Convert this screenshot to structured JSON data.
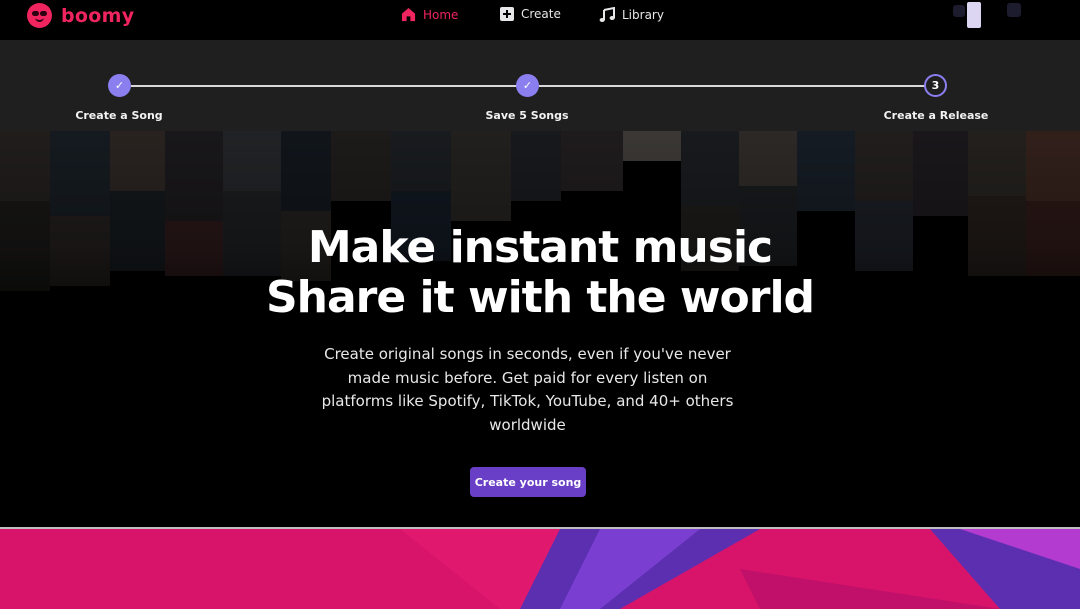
{
  "brand": {
    "name": "boomy",
    "accent": "#f0245f",
    "icon": "boomy-face-logo"
  },
  "nav": {
    "items": [
      {
        "label": "Home",
        "icon": "home-icon",
        "active": true
      },
      {
        "label": "Create",
        "icon": "plus-square-icon",
        "active": false
      },
      {
        "label": "Library",
        "icon": "music-note-icon",
        "active": false
      }
    ]
  },
  "stepper": {
    "steps": [
      {
        "label": "Create a Song",
        "status": "complete",
        "marker": "✓"
      },
      {
        "label": "Save 5 Songs",
        "status": "complete",
        "marker": "✓"
      },
      {
        "label": "Create a Release",
        "status": "pending",
        "marker": "3"
      }
    ],
    "accent": "#8b7ff0"
  },
  "hero": {
    "title_line1": "Make instant music",
    "title_line2": "Share it with the world",
    "subtitle": "Create original songs in seconds, even if you've never made music before. Get paid for every listen on platforms like Spotify, TikTok, YouTube, and 40+ others worldwide",
    "cta_label": "Create your song",
    "cta_color": "#6a3fc7"
  },
  "banner": {
    "colors": [
      "#d8146a",
      "#5b2fb0",
      "#b33bd0"
    ]
  }
}
